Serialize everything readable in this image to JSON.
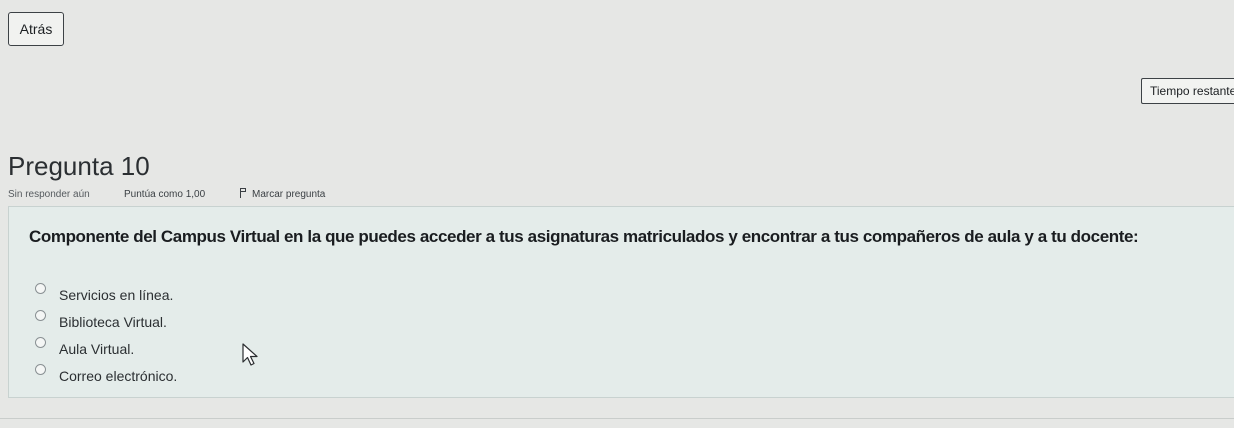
{
  "header": {
    "back_label": "Atrás",
    "timer_label": "Tiempo restante"
  },
  "question": {
    "title": "Pregunta 10",
    "status": "Sin responder aún",
    "score": "Puntúa como 1,00",
    "flag_label": "Marcar pregunta",
    "text": "Componente del Campus Virtual en la que puedes acceder a tus asignaturas matriculados y encontrar a tus compañeros de aula y a tu docente:",
    "options": [
      {
        "label": "Servicios en línea."
      },
      {
        "label": "Biblioteca Virtual."
      },
      {
        "label": "Aula Virtual."
      },
      {
        "label": "Correo electrónico."
      }
    ]
  },
  "icons": {
    "flag": "flag-icon",
    "cursor": "mouse-pointer-icon",
    "radio": "radio-unchecked-icon"
  },
  "colors": {
    "page_background": "#e6e7e5",
    "question_panel": "#e4ecea"
  }
}
